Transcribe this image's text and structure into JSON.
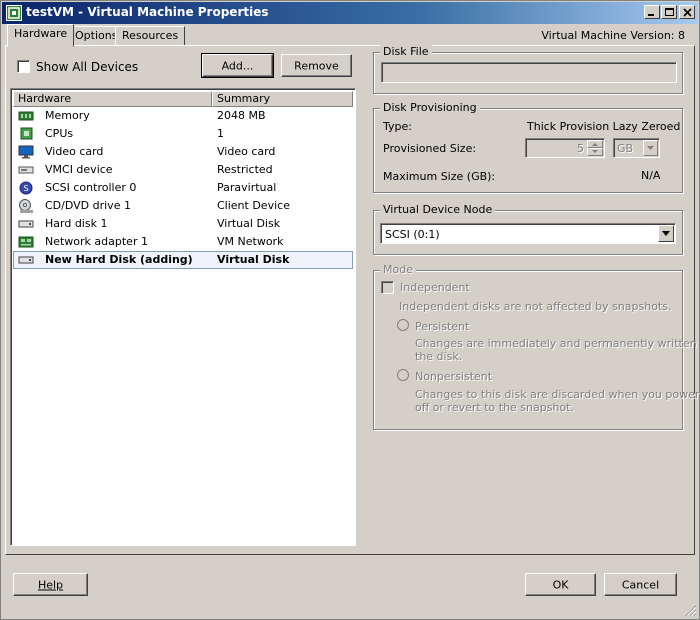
{
  "window": {
    "title": "testVM - Virtual Machine Properties",
    "version_label": "Virtual Machine Version: 8",
    "controls": {
      "minimize": "_",
      "maximize": "□",
      "close": "X"
    }
  },
  "tabs": [
    {
      "label": "Hardware",
      "active": true
    },
    {
      "label": "Options",
      "active": false
    },
    {
      "label": "Resources",
      "active": false
    }
  ],
  "hardware": {
    "show_all_label": "Show All Devices",
    "show_all_checked": false,
    "add_label": "Add...",
    "remove_label": "Remove",
    "columns": [
      "Hardware",
      "Summary"
    ],
    "rows": [
      {
        "name": "Memory",
        "summary": "2048 MB",
        "icon": "memory-icon"
      },
      {
        "name": "CPUs",
        "summary": "1",
        "icon": "cpu-icon"
      },
      {
        "name": "Video card",
        "summary": "Video card",
        "icon": "monitor-icon"
      },
      {
        "name": "VMCI device",
        "summary": "Restricted",
        "icon": "device-icon"
      },
      {
        "name": "SCSI controller 0",
        "summary": "Paravirtual",
        "icon": "scsi-icon"
      },
      {
        "name": "CD/DVD drive 1",
        "summary": "Client Device",
        "icon": "cd-icon"
      },
      {
        "name": "Hard disk 1",
        "summary": "Virtual Disk",
        "icon": "harddisk-icon"
      },
      {
        "name": "Network adapter 1",
        "summary": "VM Network",
        "icon": "network-icon"
      },
      {
        "name": "New Hard Disk (adding)",
        "summary": "Virtual Disk",
        "icon": "harddisk-icon",
        "selected": true
      }
    ]
  },
  "disk_file": {
    "title": "Disk File",
    "value": ""
  },
  "disk_provisioning": {
    "title": "Disk Provisioning",
    "type_label": "Type:",
    "type_value": "Thick Provision Lazy Zeroed",
    "size_label": "Provisioned Size:",
    "size_value": "5",
    "unit_value": "GB",
    "max_label": "Maximum Size (GB):",
    "max_value": "N/A"
  },
  "virtual_device_node": {
    "title": "Virtual Device Node",
    "selected": "SCSI (0:1)"
  },
  "mode": {
    "title": "Mode",
    "independent_label": "Independent",
    "independent_desc": "Independent disks are not affected by snapshots.",
    "persistent_label": "Persistent",
    "persistent_desc_1": "Changes are immediately and permanently written to",
    "persistent_desc_2": "the disk.",
    "nonpersistent_label": "Nonpersistent",
    "nonpersistent_desc_1": "Changes to this disk are discarded when you power",
    "nonpersistent_desc_2": "off or revert to the snapshot."
  },
  "footer": {
    "help_label": "Help",
    "ok_label": "OK",
    "cancel_label": "Cancel"
  }
}
